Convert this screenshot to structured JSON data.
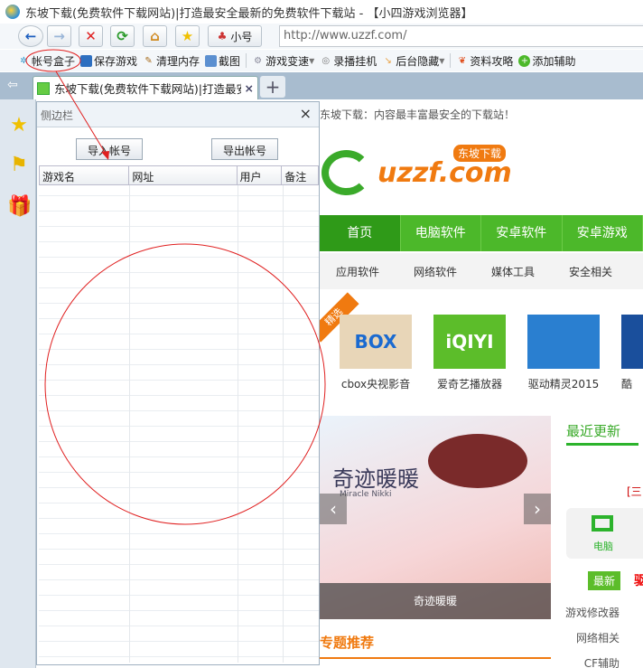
{
  "window": {
    "title": "东坡下载(免费软件下载网站)|打造最安全最新的免费软件下载站 - 【小四游戏浏览器】"
  },
  "nav": {
    "alt_account_label": "小号",
    "url": "http://www.uzzf.com/"
  },
  "toolbar": {
    "items": [
      "帐号盒子",
      "保存游戏",
      "清理内存",
      "截图",
      "游戏变速",
      "录播挂机",
      "后台隐藏",
      "资料攻略",
      "添加辅助"
    ]
  },
  "tab": {
    "label": "东坡下载(免费软件下载网站)|打造最安全",
    "close": "×",
    "new_tab": "+"
  },
  "sidebar": {
    "title": "侧边栏",
    "close": "×",
    "import_label": "导入帐号",
    "export_label": "导出帐号",
    "columns": [
      "游戏名",
      "网址",
      "用户",
      "备注"
    ]
  },
  "page": {
    "slogan": "东坡下载：内容最丰富最安全的下载站！",
    "logo": "uzzf.com",
    "logo_badge": "东坡下载",
    "main_nav": [
      "首页",
      "电脑软件",
      "安卓软件",
      "安卓游戏"
    ],
    "sub_nav": [
      "应用软件",
      "网络软件",
      "媒体工具",
      "安全相关"
    ],
    "featured_badge": "精选",
    "apps": [
      {
        "name": "cbox央视影音",
        "color": "#e8d6b8"
      },
      {
        "name": "爱奇艺播放器",
        "color": "#5cbd2a"
      },
      {
        "name": "驱动精灵2015",
        "color": "#2a7fd0"
      },
      {
        "name": "酷",
        "color": "#1a4f9c"
      }
    ],
    "banner_title": "奇迹暖暖",
    "banner_subtitle": "Miracle Nikki",
    "banner_caption": "奇迹暖暖",
    "recent_title": "最近更新",
    "recent_bracket": "[三",
    "pc_label": "电脑",
    "newest_badge": "最新",
    "newest_text": "驱",
    "categories": [
      "游戏修改器",
      "网络相关",
      "CF辅助"
    ],
    "special_title": "专题推荐"
  }
}
